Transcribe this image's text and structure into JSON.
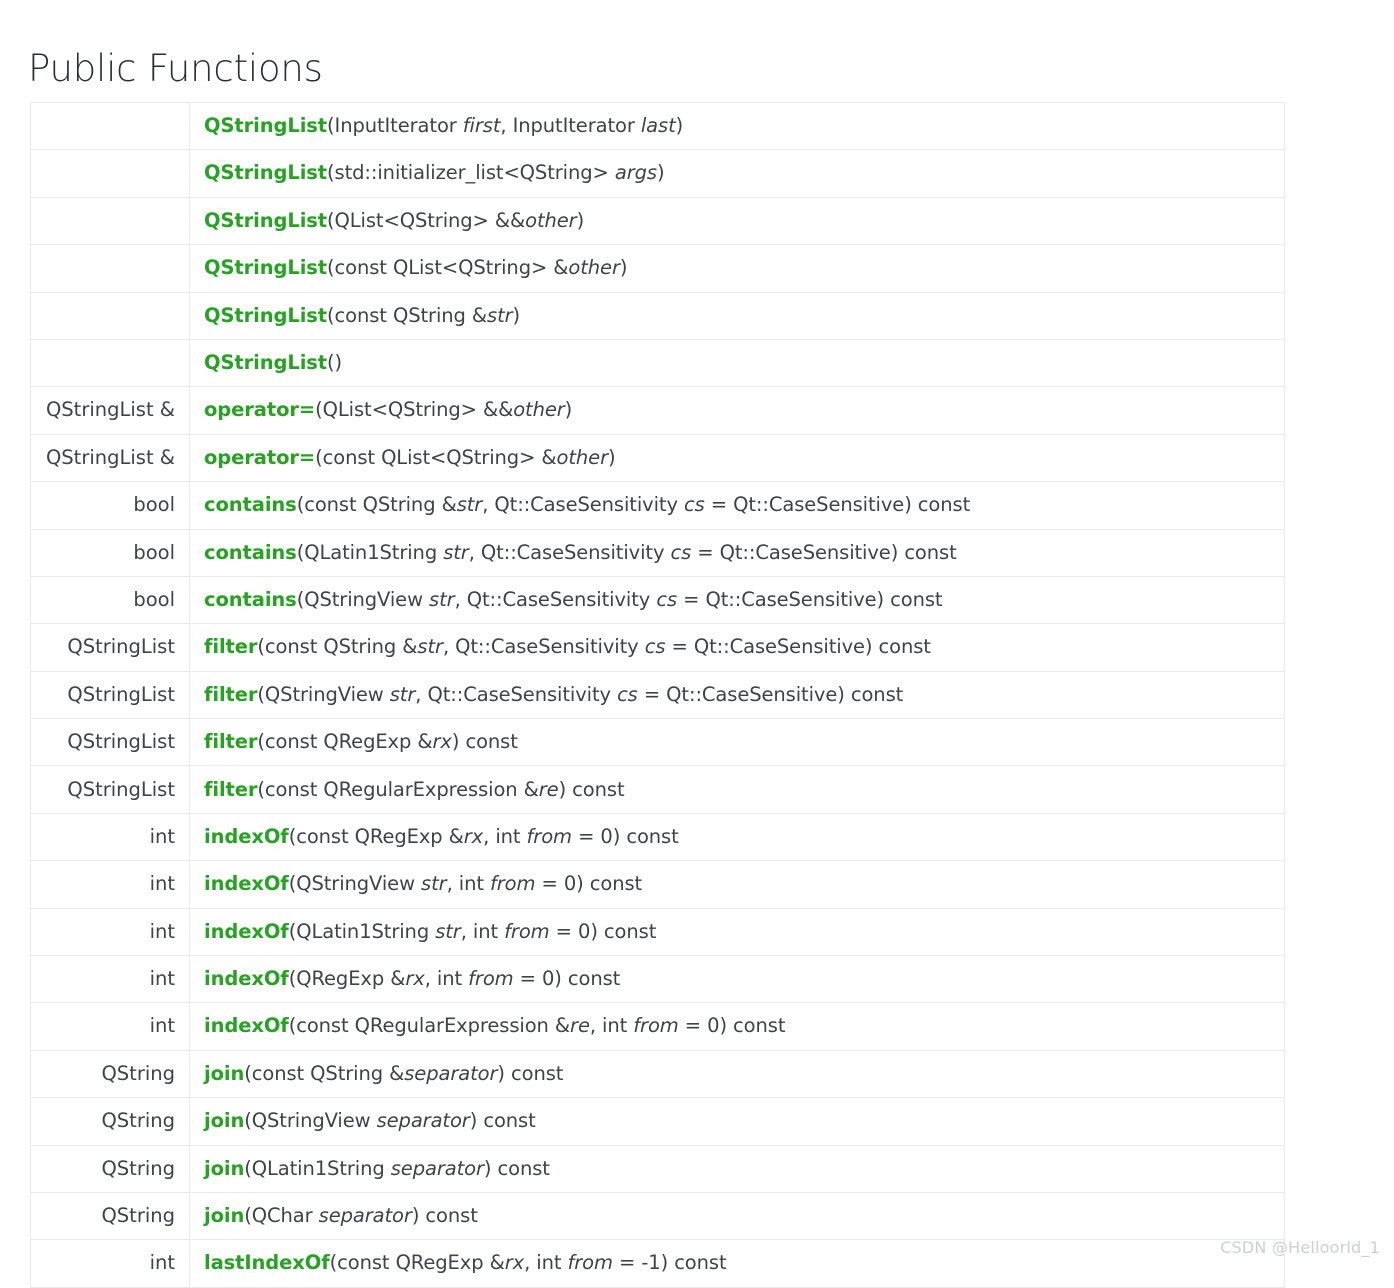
{
  "header": {
    "title": "Public Functions"
  },
  "watermark": {
    "text": "CSDN @Helloorld_1"
  },
  "colors": {
    "function_name": "#27a324",
    "body_text": "#3f4347",
    "title_text": "#2b2f33",
    "border": "#e9e9e9",
    "background": "#ffffff",
    "watermark": "#cdd0d2"
  },
  "table": {
    "columns": [
      "return_type",
      "signature"
    ],
    "column_headers_visible": false,
    "row_count": 25,
    "last_row_clipped": true,
    "rows": [
      {
        "return_type": "",
        "name": "QStringList",
        "args": "(InputIterator first, InputIterator last)",
        "signature": "QStringList(InputIterator first, InputIterator last)",
        "params": [
          "first",
          "last"
        ],
        "suffix": ""
      },
      {
        "return_type": "",
        "name": "QStringList",
        "args": "(std::initializer_list<QString> args)",
        "signature": "QStringList(std::initializer_list<QString> args)",
        "params": [
          "args"
        ],
        "suffix": ""
      },
      {
        "return_type": "",
        "name": "QStringList",
        "args": "(QList<QString> &&other)",
        "signature": "QStringList(QList<QString> &&other)",
        "params": [
          "other"
        ],
        "suffix": ""
      },
      {
        "return_type": "",
        "name": "QStringList",
        "args": "(const QList<QString> &other)",
        "signature": "QStringList(const QList<QString> &other)",
        "params": [
          "other"
        ],
        "suffix": ""
      },
      {
        "return_type": "",
        "name": "QStringList",
        "args": "(const QString &str)",
        "signature": "QStringList(const QString &str)",
        "params": [
          "str"
        ],
        "suffix": ""
      },
      {
        "return_type": "",
        "name": "QStringList",
        "args": "()",
        "signature": "QStringList()",
        "params": [],
        "suffix": ""
      },
      {
        "return_type": "QStringList &",
        "name": "operator=",
        "args": "(QList<QString> &&other)",
        "signature": "operator=(QList<QString> &&other)",
        "params": [
          "other"
        ],
        "suffix": ""
      },
      {
        "return_type": "QStringList &",
        "name": "operator=",
        "args": "(const QList<QString> &other)",
        "signature": "operator=(const QList<QString> &other)",
        "params": [
          "other"
        ],
        "suffix": ""
      },
      {
        "return_type": "bool",
        "name": "contains",
        "args": "(const QString &str, Qt::CaseSensitivity cs = Qt::CaseSensitive) const",
        "signature": "contains(const QString &str, Qt::CaseSensitivity cs = Qt::CaseSensitive) const",
        "params": [
          "str",
          "cs"
        ],
        "suffix": "const"
      },
      {
        "return_type": "bool",
        "name": "contains",
        "args": "(QLatin1String str, Qt::CaseSensitivity cs = Qt::CaseSensitive) const",
        "signature": "contains(QLatin1String str, Qt::CaseSensitivity cs = Qt::CaseSensitive) const",
        "params": [
          "str",
          "cs"
        ],
        "suffix": "const"
      },
      {
        "return_type": "bool",
        "name": "contains",
        "args": "(QStringView str, Qt::CaseSensitivity cs = Qt::CaseSensitive) const",
        "signature": "contains(QStringView str, Qt::CaseSensitivity cs = Qt::CaseSensitive) const",
        "params": [
          "str",
          "cs"
        ],
        "suffix": "const"
      },
      {
        "return_type": "QStringList",
        "name": "filter",
        "args": "(const QString &str, Qt::CaseSensitivity cs = Qt::CaseSensitive) const",
        "signature": "filter(const QString &str, Qt::CaseSensitivity cs = Qt::CaseSensitive) const",
        "params": [
          "str",
          "cs"
        ],
        "suffix": "const"
      },
      {
        "return_type": "QStringList",
        "name": "filter",
        "args": "(QStringView str, Qt::CaseSensitivity cs = Qt::CaseSensitive) const",
        "signature": "filter(QStringView str, Qt::CaseSensitivity cs = Qt::CaseSensitive) const",
        "params": [
          "str",
          "cs"
        ],
        "suffix": "const"
      },
      {
        "return_type": "QStringList",
        "name": "filter",
        "args": "(const QRegExp &rx) const",
        "signature": "filter(const QRegExp &rx) const",
        "params": [
          "rx"
        ],
        "suffix": "const"
      },
      {
        "return_type": "QStringList",
        "name": "filter",
        "args": "(const QRegularExpression &re) const",
        "signature": "filter(const QRegularExpression &re) const",
        "params": [
          "re"
        ],
        "suffix": "const"
      },
      {
        "return_type": "int",
        "name": "indexOf",
        "args": "(const QRegExp &rx, int from = 0) const",
        "signature": "indexOf(const QRegExp &rx, int from = 0) const",
        "params": [
          "rx",
          "from"
        ],
        "suffix": "const"
      },
      {
        "return_type": "int",
        "name": "indexOf",
        "args": "(QStringView str, int from = 0) const",
        "signature": "indexOf(QStringView str, int from = 0) const",
        "params": [
          "str",
          "from"
        ],
        "suffix": "const"
      },
      {
        "return_type": "int",
        "name": "indexOf",
        "args": "(QLatin1String str, int from = 0) const",
        "signature": "indexOf(QLatin1String str, int from = 0) const",
        "params": [
          "str",
          "from"
        ],
        "suffix": "const"
      },
      {
        "return_type": "int",
        "name": "indexOf",
        "args": "(QRegExp &rx, int from = 0) const",
        "signature": "indexOf(QRegExp &rx, int from = 0) const",
        "params": [
          "rx",
          "from"
        ],
        "suffix": "const"
      },
      {
        "return_type": "int",
        "name": "indexOf",
        "args": "(const QRegularExpression &re, int from = 0) const",
        "signature": "indexOf(const QRegularExpression &re, int from = 0) const",
        "params": [
          "re",
          "from"
        ],
        "suffix": "const"
      },
      {
        "return_type": "QString",
        "name": "join",
        "args": "(const QString &separator) const",
        "signature": "join(const QString &separator) const",
        "params": [
          "separator"
        ],
        "suffix": "const"
      },
      {
        "return_type": "QString",
        "name": "join",
        "args": "(QStringView separator) const",
        "signature": "join(QStringView separator) const",
        "params": [
          "separator"
        ],
        "suffix": "const"
      },
      {
        "return_type": "QString",
        "name": "join",
        "args": "(QLatin1String separator) const",
        "signature": "join(QLatin1String separator) const",
        "params": [
          "separator"
        ],
        "suffix": "const"
      },
      {
        "return_type": "QString",
        "name": "join",
        "args": "(QChar separator) const",
        "signature": "join(QChar separator) const",
        "params": [
          "separator"
        ],
        "suffix": "const"
      },
      {
        "return_type": "int",
        "name": "lastIndexOf",
        "args": "(const QRegExp &rx, int from = -1) const",
        "signature": "lastIndexOf(const QRegExp &rx, int from = -1) const",
        "params": [
          "rx",
          "from"
        ],
        "suffix": "const"
      }
    ]
  }
}
